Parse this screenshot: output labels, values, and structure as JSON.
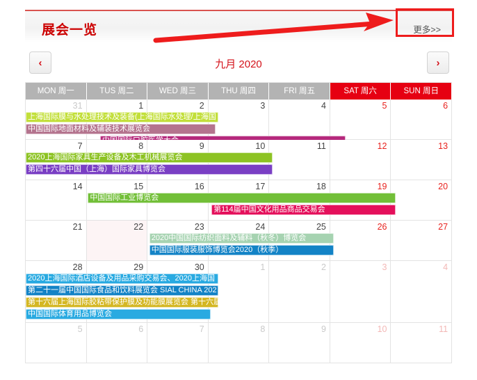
{
  "header": {
    "title": "展会一览",
    "more_label": "更多>>",
    "accent_color": "#cc0000",
    "annotation_color": "#ee1c1c"
  },
  "nav": {
    "prev_icon": "chevron-left-icon",
    "next_icon": "chevron-right-icon",
    "prev_glyph": "‹",
    "next_glyph": "›",
    "month_label": "九月 2020"
  },
  "weekdays": [
    {
      "label": "MON 周一",
      "weekend": false
    },
    {
      "label": "TUS 周二",
      "weekend": false
    },
    {
      "label": "WED 周三",
      "weekend": false
    },
    {
      "label": "THU 周四",
      "weekend": false
    },
    {
      "label": "FRI 周五",
      "weekend": false
    },
    {
      "label": "SAT 周六",
      "weekend": true
    },
    {
      "label": "SUN 周日",
      "weekend": true
    }
  ],
  "weeks": [
    {
      "tall": false,
      "days": [
        {
          "num": "31",
          "muted": true,
          "weekend": false,
          "today": false
        },
        {
          "num": "1",
          "muted": false,
          "weekend": false,
          "today": false
        },
        {
          "num": "2",
          "muted": false,
          "weekend": false,
          "today": false
        },
        {
          "num": "3",
          "muted": false,
          "weekend": false,
          "today": false
        },
        {
          "num": "4",
          "muted": false,
          "weekend": false,
          "today": false
        },
        {
          "num": "5",
          "muted": false,
          "weekend": true,
          "today": false
        },
        {
          "num": "6",
          "muted": false,
          "weekend": true,
          "today": false
        }
      ],
      "events": [
        {
          "text": "上海国际膜与水处理技术及装备(上海国际水处理/上海国",
          "start": 0,
          "span": 3.16,
          "row": 0,
          "color": "#c2df3a",
          "text_color": "#ffffff"
        },
        {
          "text": "中国国际地面材料及辅装技术展览会",
          "start": 0,
          "span": 3.12,
          "row": 1,
          "color": "#b4748e",
          "text_color": "#ffffff"
        },
        {
          "text": "中国国际口腔医学大会",
          "start": 1.22,
          "span": 4.03,
          "row": 2,
          "color": "#b5297c",
          "text_color": "#ffffff"
        }
      ]
    },
    {
      "tall": false,
      "days": [
        {
          "num": "7",
          "muted": false,
          "weekend": false,
          "today": false
        },
        {
          "num": "8",
          "muted": false,
          "weekend": false,
          "today": false
        },
        {
          "num": "9",
          "muted": false,
          "weekend": false,
          "today": false
        },
        {
          "num": "10",
          "muted": false,
          "weekend": false,
          "today": false
        },
        {
          "num": "11",
          "muted": false,
          "weekend": false,
          "today": false
        },
        {
          "num": "12",
          "muted": false,
          "weekend": true,
          "today": false
        },
        {
          "num": "13",
          "muted": false,
          "weekend": true,
          "today": false
        }
      ],
      "events": [
        {
          "text": "2020上海国际家具生产设备及木工机械展览会",
          "start": 0,
          "span": 4.05,
          "row": 0,
          "color": "#8dc324",
          "text_color": "#ffffff"
        },
        {
          "text": "第四十六届中国（上海）国际家具博览会",
          "start": 0,
          "span": 4.05,
          "row": 1,
          "color": "#7a3fc4",
          "text_color": "#ffffff"
        }
      ]
    },
    {
      "tall": false,
      "days": [
        {
          "num": "14",
          "muted": false,
          "weekend": false,
          "today": false
        },
        {
          "num": "15",
          "muted": false,
          "weekend": false,
          "today": false
        },
        {
          "num": "16",
          "muted": false,
          "weekend": false,
          "today": false
        },
        {
          "num": "17",
          "muted": false,
          "weekend": false,
          "today": false
        },
        {
          "num": "18",
          "muted": false,
          "weekend": false,
          "today": false
        },
        {
          "num": "19",
          "muted": false,
          "weekend": true,
          "today": false
        },
        {
          "num": "20",
          "muted": false,
          "weekend": true,
          "today": false
        }
      ],
      "events": [
        {
          "text": "中国国际工业博览会",
          "start": 1.02,
          "span": 5.05,
          "row": 0,
          "color": "#72bf38",
          "text_color": "#ffffff"
        },
        {
          "text": "第114届中国文化用品商品交易会",
          "start": 3.05,
          "span": 3.02,
          "row": 1,
          "color": "#e4105b",
          "text_color": "#ffffff"
        }
      ]
    },
    {
      "tall": false,
      "days": [
        {
          "num": "21",
          "muted": false,
          "weekend": false,
          "today": false
        },
        {
          "num": "22",
          "muted": false,
          "weekend": false,
          "today": true
        },
        {
          "num": "23",
          "muted": false,
          "weekend": false,
          "today": false
        },
        {
          "num": "24",
          "muted": false,
          "weekend": false,
          "today": false
        },
        {
          "num": "25",
          "muted": false,
          "weekend": false,
          "today": false
        },
        {
          "num": "26",
          "muted": false,
          "weekend": true,
          "today": false
        },
        {
          "num": "27",
          "muted": false,
          "weekend": true,
          "today": false
        }
      ],
      "events": [
        {
          "text": "2020中国国际纺织面料及辅料（秋冬）博览会",
          "start": 2.03,
          "span": 3.03,
          "row": 0,
          "color": "#a6d3b1",
          "text_color": "#ffffff"
        },
        {
          "text": "中国国际服装服饰博览会2020（秋季）",
          "start": 2.03,
          "span": 3.03,
          "row": 1,
          "color": "#1383c6",
          "text_color": "#ffffff"
        }
      ]
    },
    {
      "tall": true,
      "days": [
        {
          "num": "28",
          "muted": false,
          "weekend": false,
          "today": false
        },
        {
          "num": "29",
          "muted": false,
          "weekend": false,
          "today": false
        },
        {
          "num": "30",
          "muted": false,
          "weekend": false,
          "today": false
        },
        {
          "num": "1",
          "muted": true,
          "weekend": false,
          "today": false
        },
        {
          "num": "2",
          "muted": true,
          "weekend": false,
          "today": false
        },
        {
          "num": "3",
          "muted": true,
          "weekend": true,
          "today": false
        },
        {
          "num": "4",
          "muted": true,
          "weekend": true,
          "today": false
        }
      ],
      "events": [
        {
          "text": "2020上海国际酒店设备及用品采购交易会、2020上海国",
          "start": 0,
          "span": 3.16,
          "row": 0,
          "color": "#29aae1",
          "text_color": "#ffffff"
        },
        {
          "text": "第二十一届中国国际食品和饮料展览会 SIAL CHINA 202",
          "start": 0,
          "span": 3.16,
          "row": 1,
          "color": "#1383c6",
          "text_color": "#ffffff"
        },
        {
          "text": "第十六届上海国际胶粘带保护膜及功能膜展览会 第十六届",
          "start": 0,
          "span": 3.16,
          "row": 2,
          "color": "#d4b723",
          "text_color": "#ffffff"
        },
        {
          "text": "中国国际体育用品博览会",
          "start": 0,
          "span": 3.04,
          "row": 3,
          "color": "#29aae1",
          "text_color": "#ffffff"
        }
      ]
    },
    {
      "tall": false,
      "days": [
        {
          "num": "5",
          "muted": true,
          "weekend": false,
          "today": false
        },
        {
          "num": "6",
          "muted": true,
          "weekend": false,
          "today": false
        },
        {
          "num": "7",
          "muted": true,
          "weekend": false,
          "today": false
        },
        {
          "num": "8",
          "muted": true,
          "weekend": false,
          "today": false
        },
        {
          "num": "9",
          "muted": true,
          "weekend": false,
          "today": false
        },
        {
          "num": "10",
          "muted": true,
          "weekend": true,
          "today": false
        },
        {
          "num": "11",
          "muted": true,
          "weekend": true,
          "today": false
        }
      ],
      "events": []
    }
  ]
}
